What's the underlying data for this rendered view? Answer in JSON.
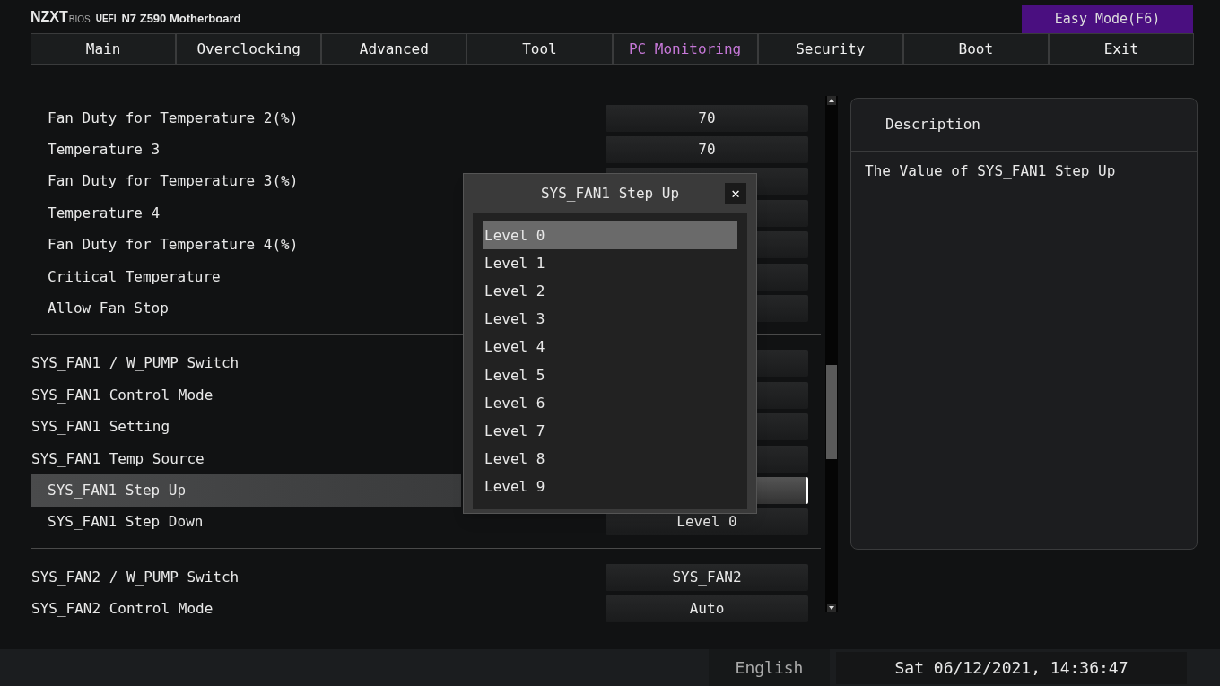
{
  "header": {
    "brand": "NZXT",
    "brand_sub": "BIOS",
    "firmware": "UEFI",
    "board": "N7 Z590 Motherboard",
    "mode_button": "Easy Mode(F6)"
  },
  "tabs": [
    {
      "label": "Main",
      "selected": false
    },
    {
      "label": "Overclocking",
      "selected": false
    },
    {
      "label": "Advanced",
      "selected": false
    },
    {
      "label": "Tool",
      "selected": false
    },
    {
      "label": "PC Monitoring",
      "selected": true
    },
    {
      "label": "Security",
      "selected": false
    },
    {
      "label": "Boot",
      "selected": false
    },
    {
      "label": "Exit",
      "selected": false
    }
  ],
  "settings": [
    {
      "rows": [
        {
          "label": "Fan Duty for Temperature 2(%)",
          "kind": "sub",
          "value": "70",
          "selected": false
        },
        {
          "label": "Temperature 3",
          "kind": "sub",
          "value": "70",
          "selected": false
        },
        {
          "label": "Fan Duty for Temperature 3(%)",
          "kind": "sub",
          "selected": false
        },
        {
          "label": "Temperature 4",
          "kind": "sub",
          "selected": false
        },
        {
          "label": "Fan Duty for Temperature 4(%)",
          "kind": "sub",
          "selected": false
        },
        {
          "label": "Critical Temperature",
          "kind": "sub",
          "selected": false
        },
        {
          "label": "Allow Fan Stop",
          "kind": "sub",
          "selected": false
        }
      ]
    },
    {
      "rows": [
        {
          "label": "SYS_FAN1 / W_PUMP Switch",
          "kind": "top",
          "selected": false
        },
        {
          "label": "SYS_FAN1 Control Mode",
          "kind": "top",
          "selected": false
        },
        {
          "label": "SYS_FAN1 Setting",
          "kind": "top",
          "selected": false
        },
        {
          "label": "SYS_FAN1 Temp Source",
          "kind": "top",
          "selected": false
        },
        {
          "label": "SYS_FAN1 Step Up",
          "kind": "sub",
          "selected": true
        },
        {
          "label": "SYS_FAN1 Step Down",
          "kind": "sub",
          "value": "Level 0",
          "selected": false
        }
      ]
    },
    {
      "rows": [
        {
          "label": "SYS_FAN2 / W_PUMP Switch",
          "kind": "top",
          "value": "SYS_FAN2",
          "selected": false
        },
        {
          "label": "SYS_FAN2 Control Mode",
          "kind": "top",
          "value": "Auto",
          "selected": false
        }
      ]
    }
  ],
  "description": {
    "title": "Description",
    "text": "The Value of SYS_FAN1 Step Up"
  },
  "dialog": {
    "title": "SYS_FAN1 Step Up",
    "close": "✕",
    "options": [
      {
        "label": "Level 0",
        "selected": true
      },
      {
        "label": "Level 1",
        "selected": false
      },
      {
        "label": "Level 2",
        "selected": false
      },
      {
        "label": "Level 3",
        "selected": false
      },
      {
        "label": "Level 4",
        "selected": false
      },
      {
        "label": "Level 5",
        "selected": false
      },
      {
        "label": "Level 6",
        "selected": false
      },
      {
        "label": "Level 7",
        "selected": false
      },
      {
        "label": "Level 8",
        "selected": false
      },
      {
        "label": "Level 9",
        "selected": false
      }
    ]
  },
  "status_bar": {
    "language": "English",
    "datetime": "Sat 06/12/2021, 14:36:47"
  }
}
